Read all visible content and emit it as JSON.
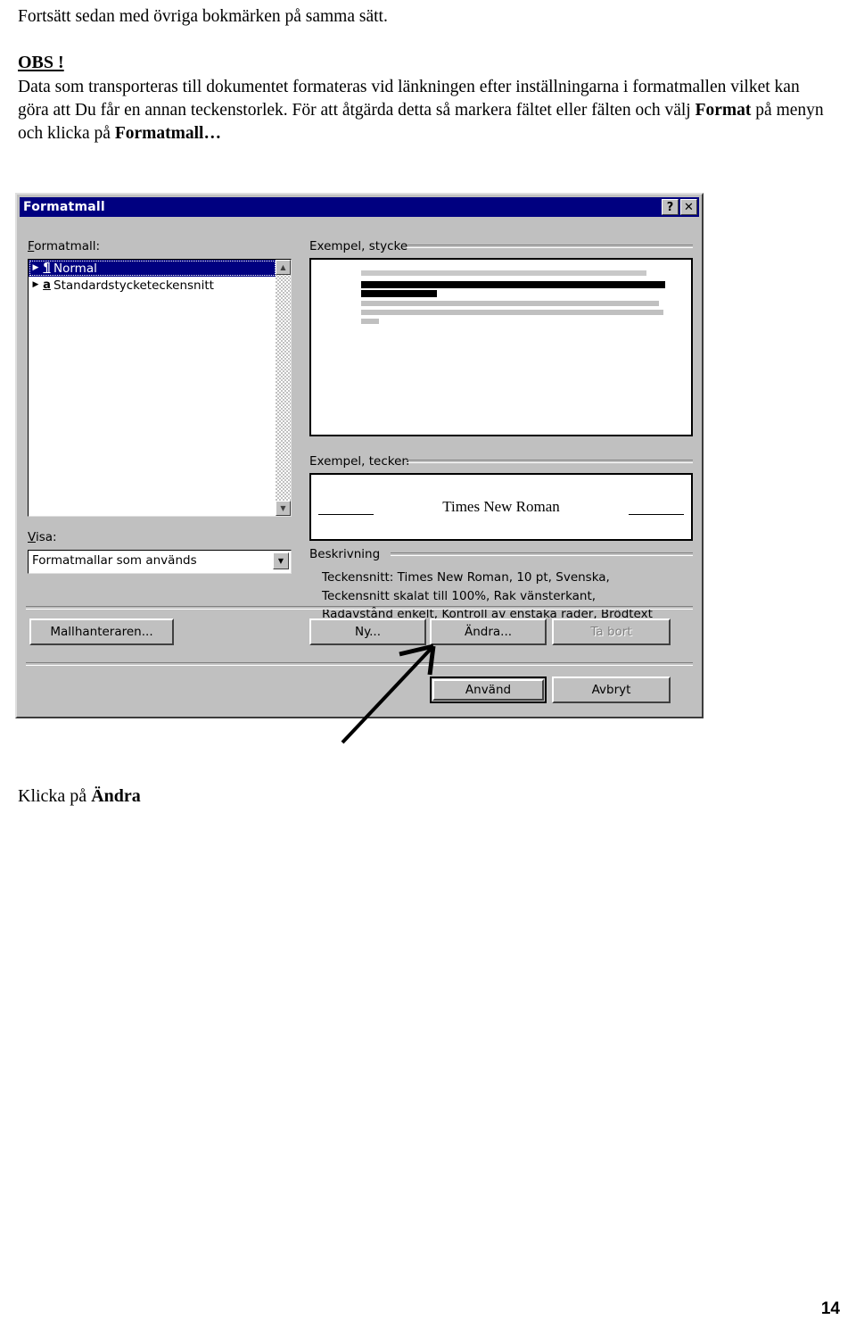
{
  "document": {
    "intro_line": "Fortsätt sedan med övriga bokmärken på samma sätt.",
    "obs_heading": "OBS !",
    "obs_body_part1": "Data som transporteras till dokumentet formateras vid länkningen efter inställningarna i formatmallen vilket kan göra att Du får en annan teckenstorlek. För att åtgärda detta så markera fältet eller fälten och välj ",
    "obs_body_bold1": "Format",
    "obs_body_part2": " på menyn och klicka på ",
    "obs_body_bold2": "Formatmall…",
    "caption_prefix": "Klicka på ",
    "caption_bold": "Ändra",
    "page_number": "14"
  },
  "dialog": {
    "title": "Formatmall",
    "titlebar_buttons": [
      {
        "name": "help-button",
        "glyph": "?"
      },
      {
        "name": "close-button",
        "glyph": "✕"
      }
    ],
    "style_label": "Formatmall:",
    "style_list": [
      {
        "label": "Normal",
        "glyph": "¶",
        "selected": true
      },
      {
        "label": "Standardstycketeckensnitt",
        "glyph": "a",
        "selected": false
      }
    ],
    "visa_label": "Visa:",
    "visa_value": "Formatmallar som används",
    "paragraph_group_label": "Exempel, stycke",
    "character_group_label": "Exempel, tecken",
    "character_sample": "Times New Roman",
    "description_group_label": "Beskrivning",
    "description_lines": [
      "Teckensnitt: Times New Roman, 10 pt, Svenska,",
      "Teckensnitt skalat till 100%, Rak vänsterkant,",
      "Radavstånd enkelt, Kontroll av enstaka rader, Brödtext"
    ],
    "buttons": {
      "organizer": "Mallhanteraren...",
      "new": "Ny...",
      "modify": "Ändra...",
      "delete": "Ta bort",
      "apply": "Använd",
      "cancel": "Avbryt"
    },
    "colors": {
      "titlebar": "#000080",
      "face": "#c0c0c0",
      "selection": "#000080",
      "disabled_text": "#808080"
    }
  }
}
